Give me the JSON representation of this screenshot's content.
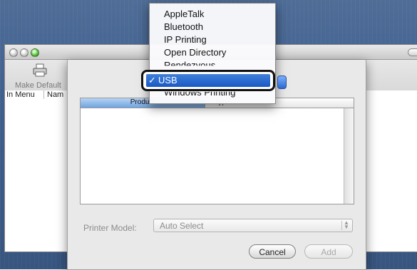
{
  "menu": {
    "items": [
      "AppleTalk",
      "Bluetooth",
      "IP Printing",
      "Open Directory",
      "Rendezvous"
    ],
    "selected": {
      "check": "✓",
      "label": "USB"
    },
    "after_selected": "Windows Printing"
  },
  "toolbar": {
    "make_default_label": "Make Default"
  },
  "columns": {
    "in_menu": "In Menu",
    "name": "Nam"
  },
  "sheet": {
    "table": {
      "headers": {
        "product": "Product",
        "type": "Type"
      }
    },
    "printer_model_label": "Printer Model:",
    "printer_model_value": "Auto Select",
    "buttons": {
      "cancel": "Cancel",
      "add": "Add"
    }
  },
  "icons": {
    "printer": "printer-icon",
    "stepper": "up-down-arrows-icon"
  },
  "colors": {
    "selection": "#1a59c4",
    "desktop": "#3f5f8e"
  }
}
